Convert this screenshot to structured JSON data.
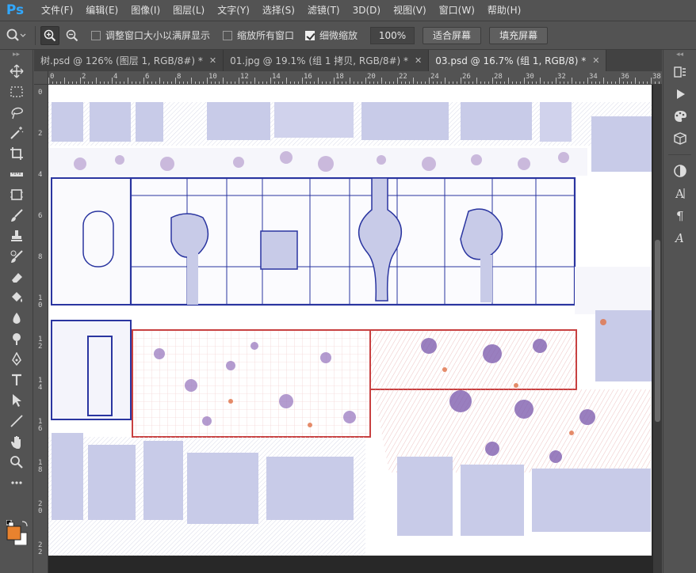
{
  "app": {
    "logo": "Ps"
  },
  "menu": [
    "文件(F)",
    "编辑(E)",
    "图像(I)",
    "图层(L)",
    "文字(Y)",
    "选择(S)",
    "滤镜(T)",
    "3D(D)",
    "视图(V)",
    "窗口(W)",
    "帮助(H)"
  ],
  "options": {
    "tool_icon": "zoom-icon",
    "resize_windows_label": "调整窗口大小以满屏显示",
    "resize_windows_checked": false,
    "zoom_all_label": "缩放所有窗口",
    "zoom_all_checked": false,
    "scrubby_label": "细微缩放",
    "scrubby_checked": true,
    "zoom_percent": "100%",
    "fit_screen_label": "适合屏幕",
    "fill_screen_label": "填充屏幕"
  },
  "tabs": [
    {
      "label": "树.psd @ 126% (图层 1, RGB/8#) *",
      "active": false
    },
    {
      "label": "01.jpg @ 19.1% (组 1 拷贝, RGB/8#) *",
      "active": false
    },
    {
      "label": "03.psd @ 16.7% (组 1, RGB/8) *",
      "active": true
    }
  ],
  "ruler_h": [
    "0",
    "2",
    "4",
    "6",
    "8",
    "10",
    "12",
    "14",
    "16",
    "18",
    "20",
    "22",
    "24",
    "26",
    "28",
    "30",
    "32",
    "34",
    "36",
    "38"
  ],
  "ruler_v": [
    "0",
    "2",
    "4",
    "6",
    "8",
    "1\n0",
    "1\n2",
    "1\n4",
    "1\n6",
    "1\n8",
    "2\n0",
    "2\n2"
  ],
  "colors": {
    "foreground": "#e8822e",
    "background": "#ffffff",
    "plan_blue": "#2a35a0",
    "plan_red": "#c84040",
    "plan_fill": "#c8cbe8"
  },
  "tools_left": [
    "move-icon",
    "marquee-icon",
    "lasso-icon",
    "magic-wand-icon",
    "crop-icon",
    "ruler-icon",
    "frame-icon",
    "brush-icon",
    "stamp-icon",
    "history-brush-icon",
    "eraser-icon",
    "bucket-icon",
    "blur-icon",
    "dodge-icon",
    "pen-icon",
    "type-icon",
    "path-select-icon",
    "line-icon",
    "hand-icon",
    "zoom-icon",
    "more-icon"
  ],
  "tools_right": [
    "history-icon",
    "play-icon",
    "palette-icon",
    "3d-icon",
    "adjust-icon",
    "character-icon",
    "paragraph-icon",
    "glyph-icon"
  ]
}
